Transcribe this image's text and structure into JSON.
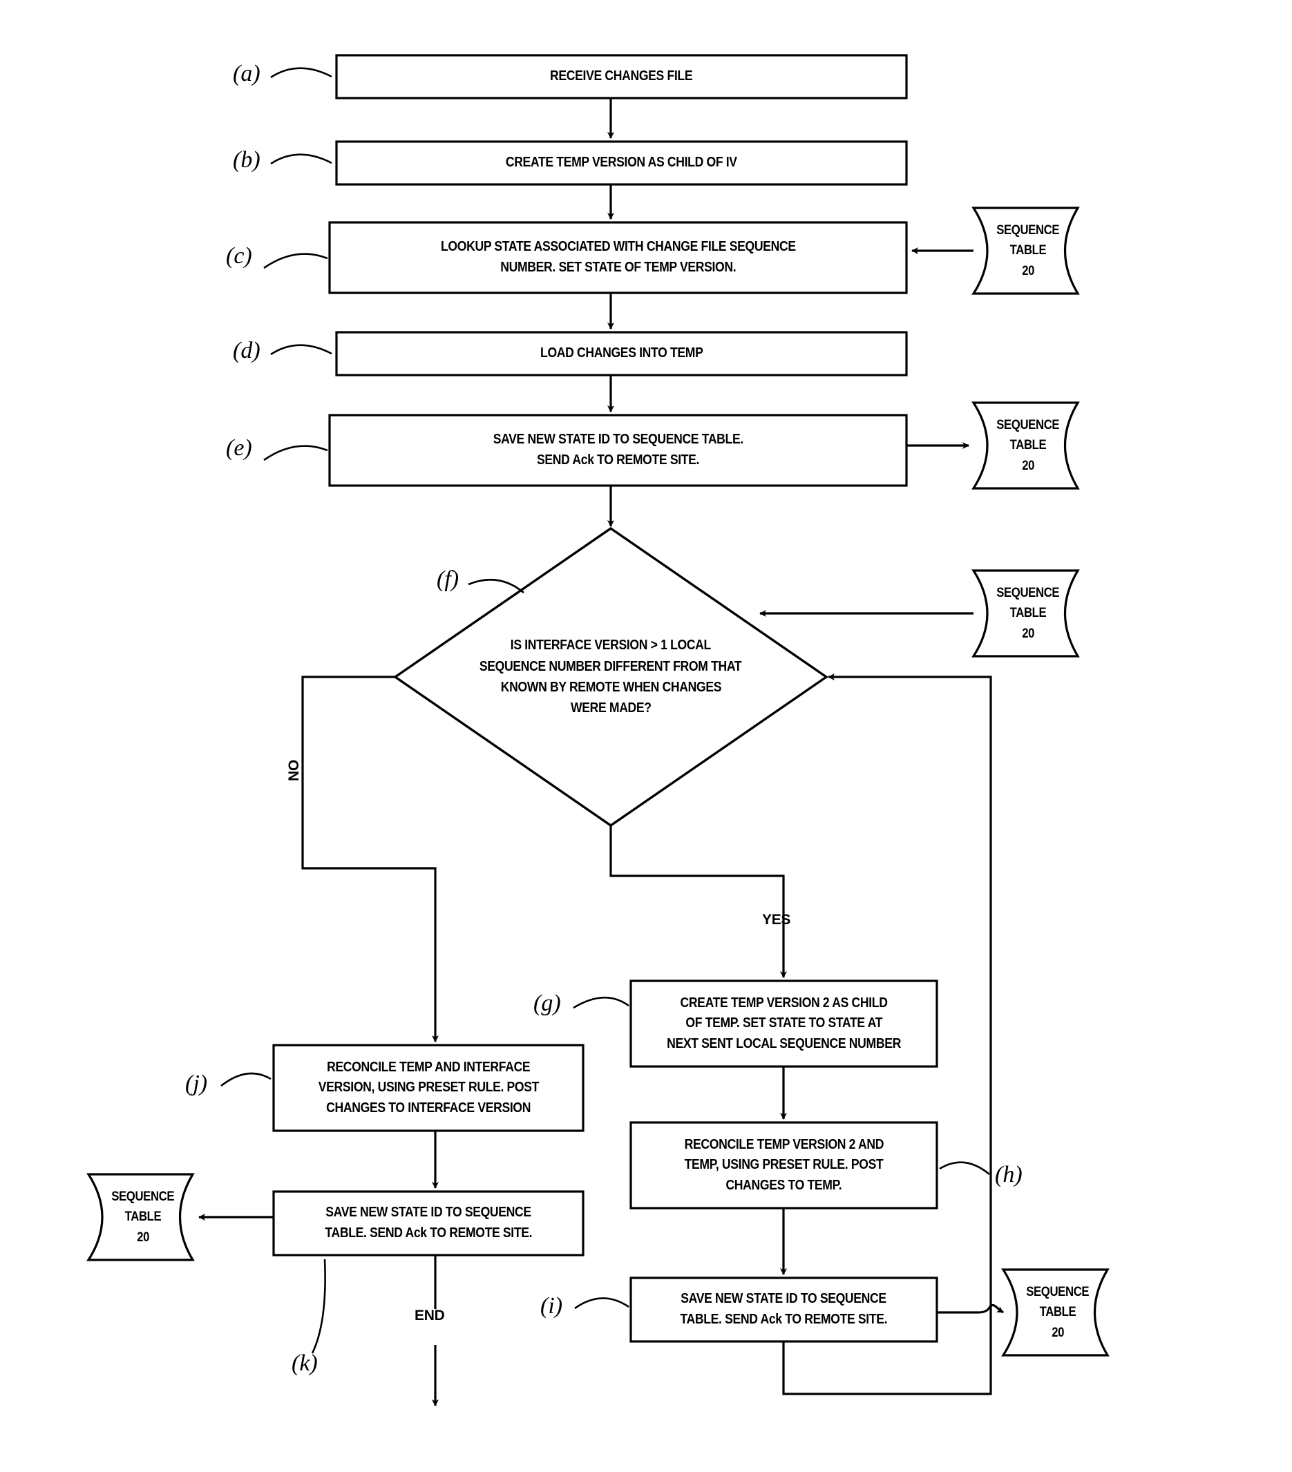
{
  "diagram": {
    "type": "flowchart",
    "title": "",
    "colors": {
      "stroke": "#000000",
      "fill": "#ffffff",
      "text": "#000000"
    },
    "nodes": {
      "a": {
        "ref": "(a)",
        "shape": "process",
        "lines": [
          "RECEIVE CHANGES FILE"
        ]
      },
      "b": {
        "ref": "(b)",
        "shape": "process",
        "lines": [
          "CREATE TEMP VERSION AS CHILD OF IV"
        ]
      },
      "c": {
        "ref": "(c)",
        "shape": "process",
        "lines": [
          "LOOKUP STATE ASSOCIATED WITH CHANGE FILE SEQUENCE",
          "NUMBER.  SET STATE OF TEMP VERSION."
        ]
      },
      "d": {
        "ref": "(d)",
        "shape": "process",
        "lines": [
          "LOAD CHANGES INTO TEMP"
        ]
      },
      "e": {
        "ref": "(e)",
        "shape": "process",
        "lines": [
          "SAVE NEW STATE ID TO SEQUENCE TABLE.",
          "SEND Ack TO REMOTE SITE."
        ]
      },
      "f": {
        "ref": "(f)",
        "shape": "decision",
        "lines": [
          "IS INTERFACE VERSION > 1 LOCAL",
          "SEQUENCE NUMBER DIFFERENT FROM THAT",
          "KNOWN BY REMOTE WHEN CHANGES",
          "WERE MADE?"
        ]
      },
      "g": {
        "ref": "(g)",
        "shape": "process",
        "lines": [
          "CREATE TEMP VERSION 2 AS CHILD",
          "OF TEMP. SET STATE TO STATE AT",
          "NEXT SENT LOCAL SEQUENCE NUMBER"
        ]
      },
      "h": {
        "ref": "(h)",
        "shape": "process",
        "lines": [
          "RECONCILE TEMP VERSION 2 AND",
          "TEMP, USING PRESET RULE. POST",
          "CHANGES TO TEMP."
        ]
      },
      "i": {
        "ref": "(i)",
        "shape": "process",
        "lines": [
          "SAVE NEW STATE ID TO SEQUENCE",
          "TABLE. SEND Ack TO REMOTE SITE."
        ]
      },
      "j": {
        "ref": "(j)",
        "shape": "process",
        "lines": [
          "RECONCILE TEMP AND INTERFACE",
          "VERSION, USING PRESET RULE. POST",
          "CHANGES TO INTERFACE VERSION"
        ]
      },
      "k": {
        "ref": "(k)",
        "shape": "process",
        "lines": [
          "SAVE NEW STATE ID TO SEQUENCE",
          "TABLE. SEND Ack TO REMOTE SITE."
        ]
      }
    },
    "datastores": [
      {
        "id": "db-c",
        "lines": [
          "SEQUENCE",
          "TABLE",
          "20"
        ]
      },
      {
        "id": "db-e",
        "lines": [
          "SEQUENCE",
          "TABLE",
          "20"
        ]
      },
      {
        "id": "db-f",
        "lines": [
          "SEQUENCE",
          "TABLE",
          "20"
        ]
      },
      {
        "id": "db-k",
        "lines": [
          "SEQUENCE",
          "TABLE",
          "20"
        ]
      },
      {
        "id": "db-i",
        "lines": [
          "SEQUENCE",
          "TABLE",
          "20"
        ]
      }
    ],
    "edge_labels": {
      "no": "NO",
      "yes": "YES",
      "end": "END"
    }
  }
}
